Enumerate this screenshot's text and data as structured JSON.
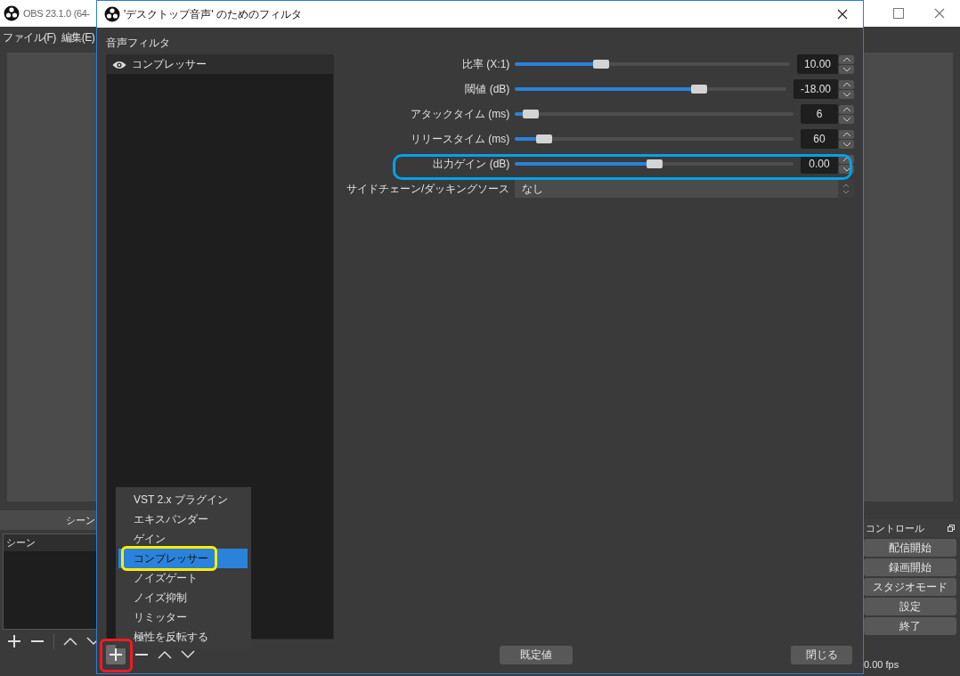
{
  "main_window": {
    "title": "OBS 23.1.0 (64-",
    "menu": [
      "ファイル(F)",
      "編集(E)"
    ],
    "scenes_dock": {
      "title": "シーン",
      "list_header": "シーン"
    },
    "controls_dock": {
      "title": "コントロール",
      "buttons": [
        "配信開始",
        "録画開始",
        "スタジオモード",
        "設定",
        "終了"
      ]
    },
    "status_bar": {
      "fps": "0.00 fps"
    }
  },
  "dialog": {
    "title": "'デスクトップ音声' のためのフィルタ",
    "filters_label": "音声フィルタ",
    "filters": [
      {
        "name": "コンプレッサー",
        "visible": true
      }
    ],
    "properties": [
      {
        "kind": "slider",
        "label": "比率 (X:1)",
        "level": 0.3,
        "value": "10.00"
      },
      {
        "kind": "slider",
        "label": "閾値 (dB)",
        "level": 0.69,
        "value": "-18.00"
      },
      {
        "kind": "slider",
        "label": "アタックタイム (ms)",
        "level": 0.03,
        "value": "6"
      },
      {
        "kind": "slider",
        "label": "リリースタイム (ms)",
        "level": 0.08,
        "value": "60"
      },
      {
        "kind": "slider",
        "label": "出力ゲイン (dB)",
        "level": 0.5,
        "value": "0.00"
      },
      {
        "kind": "dropdown",
        "label": "サイドチェーン/ダッキングソース",
        "value": "なし"
      }
    ],
    "buttons": [
      "既定値",
      "閉じる"
    ]
  },
  "add_menu": {
    "items": [
      {
        "label": "VST 2.x プラグイン",
        "selected": false
      },
      {
        "label": "エキスパンダー",
        "selected": false
      },
      {
        "label": "ゲイン",
        "selected": false
      },
      {
        "label": "コンプレッサー",
        "selected": true
      },
      {
        "label": "ノイズゲート",
        "selected": false
      },
      {
        "label": "ノイズ抑制",
        "selected": false
      },
      {
        "label": "リミッター",
        "selected": false
      },
      {
        "label": "極性を反転する",
        "selected": false
      }
    ]
  }
}
